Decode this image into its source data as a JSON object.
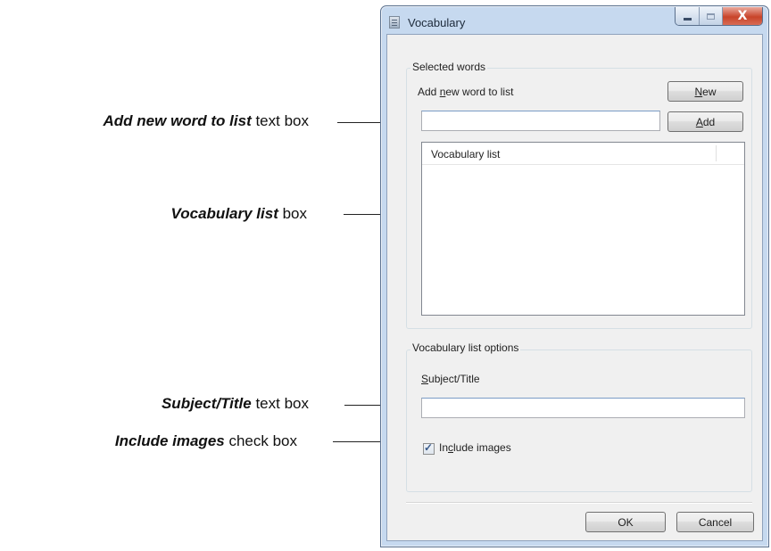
{
  "callouts": [
    {
      "bold": "Add new word to list",
      "rest": " text box"
    },
    {
      "bold": "Vocabulary list",
      "rest": " box"
    },
    {
      "bold": "Subject/Title",
      "rest": " text box"
    },
    {
      "bold": "Include images",
      "rest": " check box"
    }
  ],
  "window": {
    "title": "Vocabulary",
    "icon": "app-list-icon",
    "controls": {
      "minimize": "minimize-icon",
      "maximize": "maximize-icon",
      "close": "close-icon",
      "close_glyph": "X"
    }
  },
  "selected_words": {
    "group_label": "Selected words",
    "add_label": {
      "pre": "Add ",
      "access": "n",
      "post": "ew word to list"
    },
    "new_button": {
      "access": "N",
      "post": "ew"
    },
    "add_input_value": "",
    "add_button": {
      "access": "A",
      "post": "dd"
    },
    "list_header": "Vocabulary list",
    "items": []
  },
  "options": {
    "group_label": "Vocabulary list options",
    "subject_label": {
      "access": "S",
      "post": "ubject/Title"
    },
    "subject_value": "",
    "include_images": {
      "checked": true,
      "pre": "In",
      "access": "c",
      "post": "lude images"
    }
  },
  "footer": {
    "ok": "OK",
    "cancel": "Cancel"
  }
}
